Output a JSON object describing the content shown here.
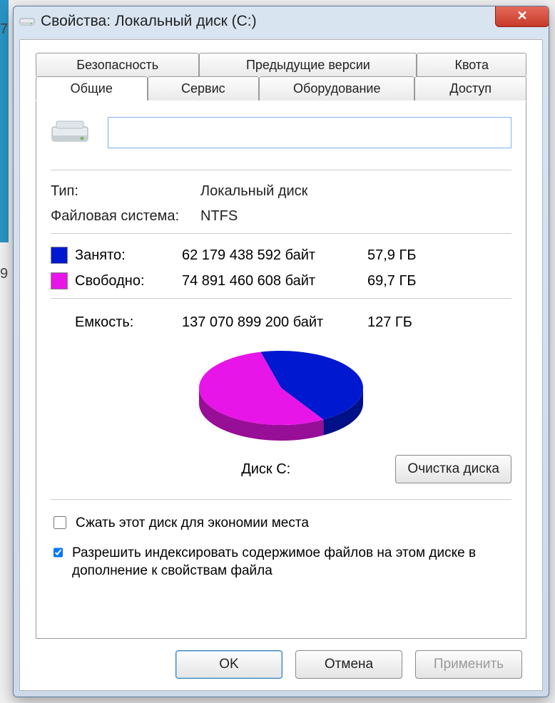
{
  "window": {
    "title": "Свойства: Локальный диск (C:)"
  },
  "tabs": {
    "top": [
      {
        "label": "Безопасность"
      },
      {
        "label": "Предыдущие версии"
      },
      {
        "label": "Квота"
      }
    ],
    "bottom": [
      {
        "label": "Общие"
      },
      {
        "label": "Сервис"
      },
      {
        "label": "Оборудование"
      },
      {
        "label": "Доступ"
      }
    ]
  },
  "general": {
    "name_value": "",
    "type_label": "Тип:",
    "type_value": "Локальный диск",
    "fs_label": "Файловая система:",
    "fs_value": "NTFS",
    "used_label": "Занято:",
    "used_bytes": "62 179 438 592 байт",
    "used_human": "57,9 ГБ",
    "free_label": "Свободно:",
    "free_bytes": "74 891 460 608 байт",
    "free_human": "69,7 ГБ",
    "cap_label": "Емкость:",
    "cap_bytes": "137 070 899 200 байт",
    "cap_human": "127 ГБ",
    "disk_caption": "Диск C:",
    "cleanup_label": "Очистка диска",
    "compress_label": "Сжать этот диск для экономии места",
    "index_label": "Разрешить индексировать содержимое файлов на этом диске в дополнение к свойствам файла",
    "compress_checked": false,
    "index_checked": true
  },
  "actions": {
    "ok": "OK",
    "cancel": "Отмена",
    "apply": "Применить"
  },
  "colors": {
    "used": "#0019d0",
    "free": "#e815e8",
    "free_side": "#9e0f9e"
  },
  "chart_data": {
    "type": "pie",
    "title": "Диск C:",
    "series": [
      {
        "name": "Занято",
        "value": 62179438592,
        "percent": 45.4,
        "color": "#0019d0"
      },
      {
        "name": "Свободно",
        "value": 74891460608,
        "percent": 54.6,
        "color": "#e815e8"
      }
    ],
    "total": 137070899200
  }
}
